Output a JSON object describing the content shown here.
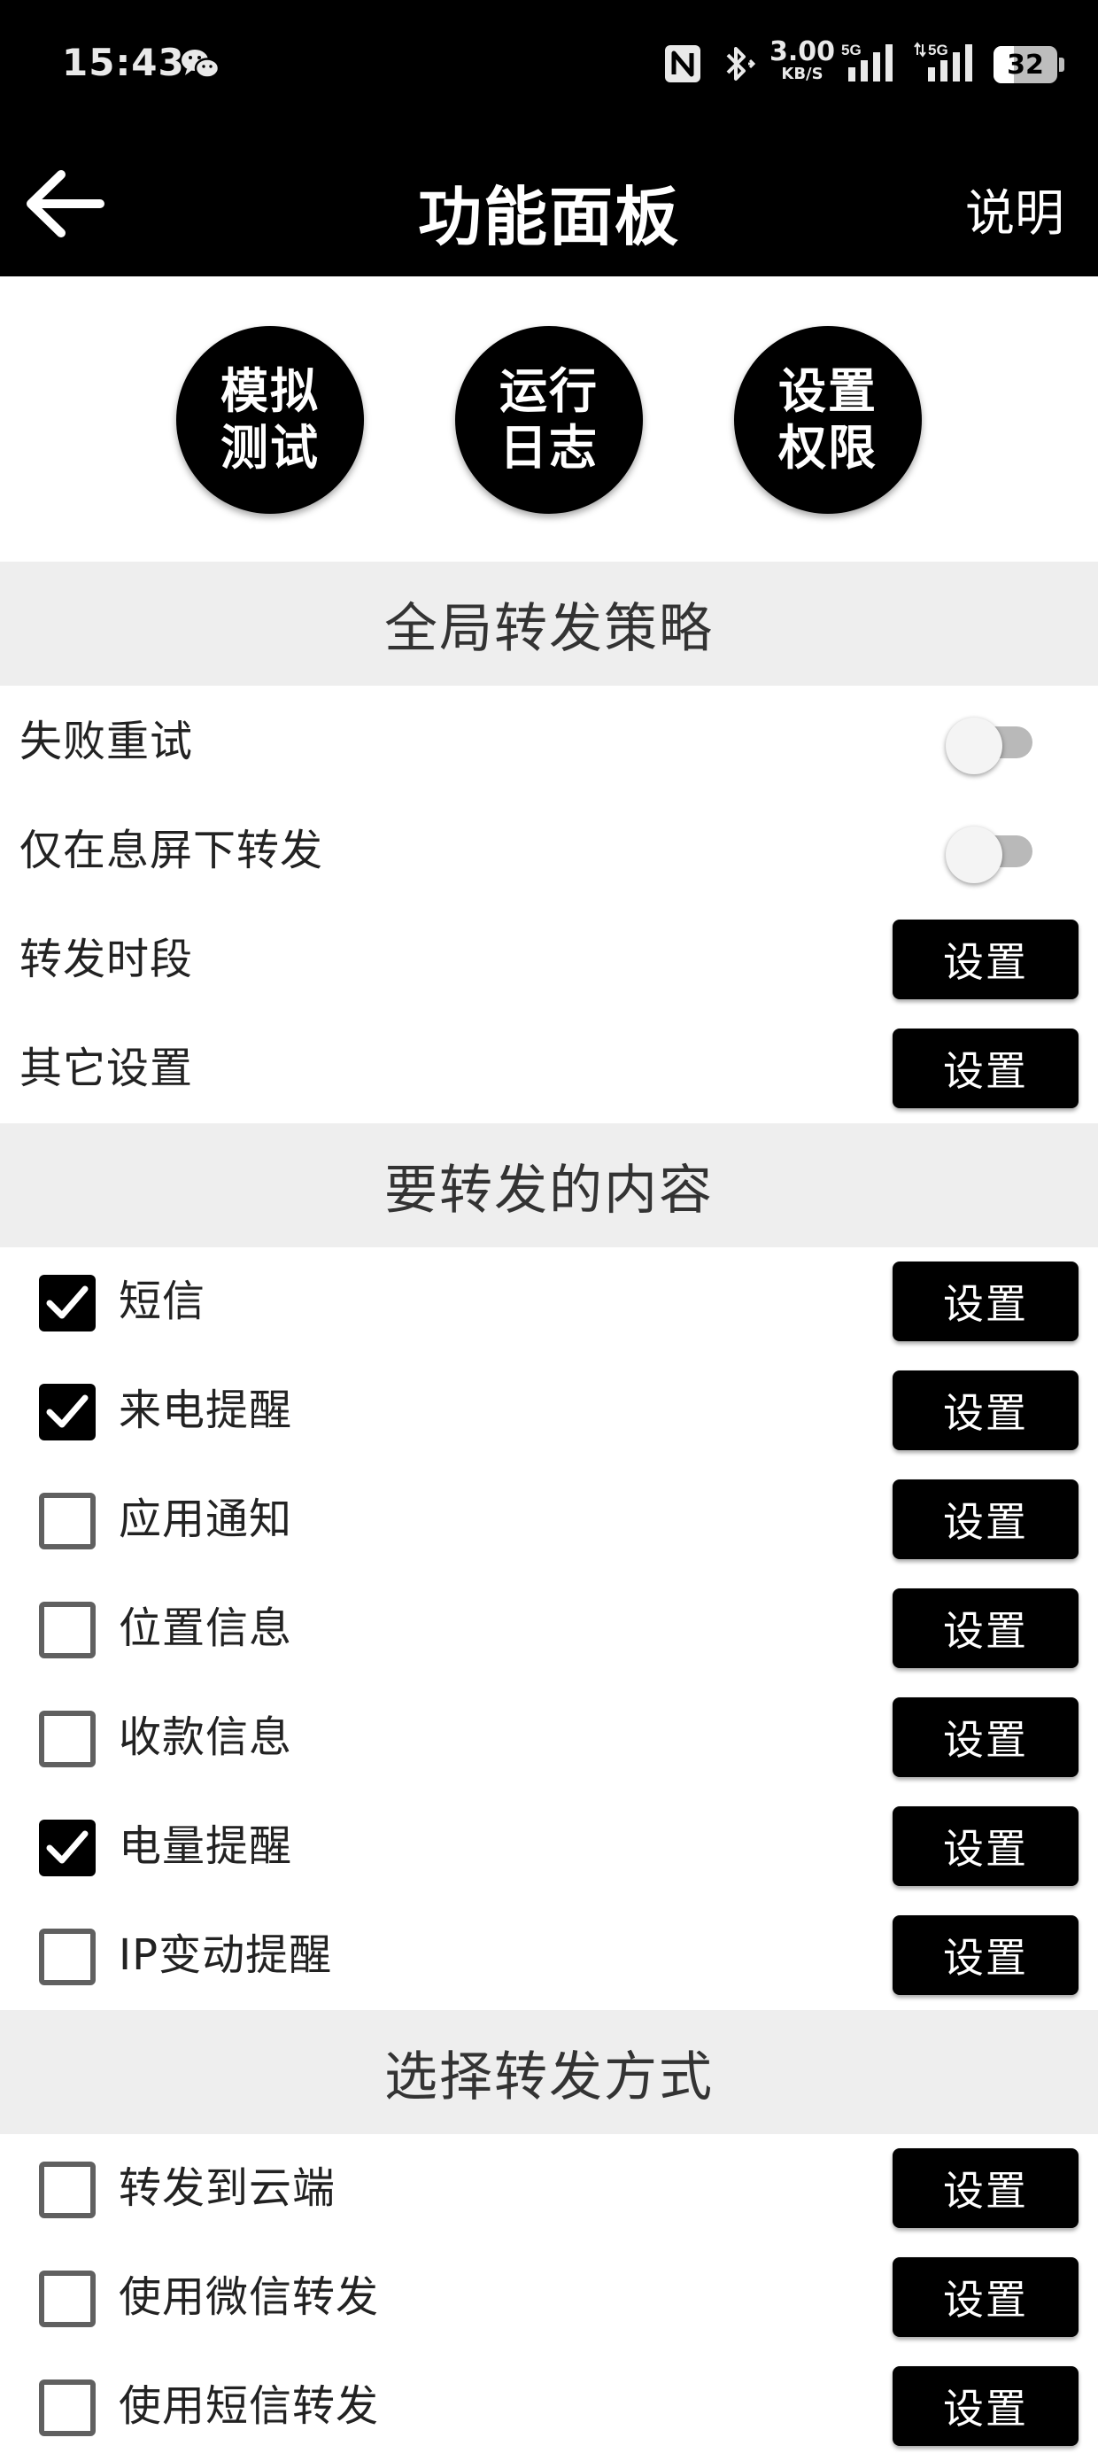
{
  "status_bar": {
    "time": "15:43",
    "chat_icon": "wechat-icon",
    "net_speed_value": "3.00",
    "net_speed_unit": "KB/S",
    "signal_1_label": "5G",
    "signal_2_label": "5G",
    "battery": "32",
    "battery_level": 0.32
  },
  "app_bar": {
    "back_icon": "arrow-left-icon",
    "title": "功能面板",
    "help_label": "说明"
  },
  "quick_actions": [
    {
      "line1": "模拟",
      "line2": "测试"
    },
    {
      "line1": "运行",
      "line2": "日志"
    },
    {
      "line1": "设置",
      "line2": "权限"
    }
  ],
  "sections": {
    "global_strategy": {
      "title": "全局转发策略",
      "rows": [
        {
          "label": "失败重试",
          "control": "toggle",
          "on": false
        },
        {
          "label": "仅在息屏下转发",
          "control": "toggle",
          "on": false
        },
        {
          "label": "转发时段",
          "button": "设置"
        },
        {
          "label": "其它设置",
          "button": "设置"
        }
      ]
    },
    "content": {
      "title": "要转发的内容",
      "rows": [
        {
          "label": "短信",
          "checked": true,
          "button": "设置"
        },
        {
          "label": "来电提醒",
          "checked": true,
          "button": "设置"
        },
        {
          "label": "应用通知",
          "checked": false,
          "button": "设置"
        },
        {
          "label": "位置信息",
          "checked": false,
          "button": "设置"
        },
        {
          "label": "收款信息",
          "checked": false,
          "button": "设置"
        },
        {
          "label": "电量提醒",
          "checked": true,
          "button": "设置"
        },
        {
          "label": "IP变动提醒",
          "checked": false,
          "button": "设置"
        }
      ]
    },
    "method": {
      "title": "选择转发方式",
      "rows": [
        {
          "label": "转发到云端",
          "checked": false,
          "button": "设置"
        },
        {
          "label": "使用微信转发",
          "checked": false,
          "button": "设置"
        },
        {
          "label": "使用短信转发",
          "checked": false,
          "button": "设置"
        }
      ]
    }
  },
  "colors": {
    "bar_background": "#000000",
    "section_background": "#eeeeee",
    "button_background": "#000000",
    "button_text": "#ffffff",
    "toggle_track": "#b9b9b9"
  }
}
